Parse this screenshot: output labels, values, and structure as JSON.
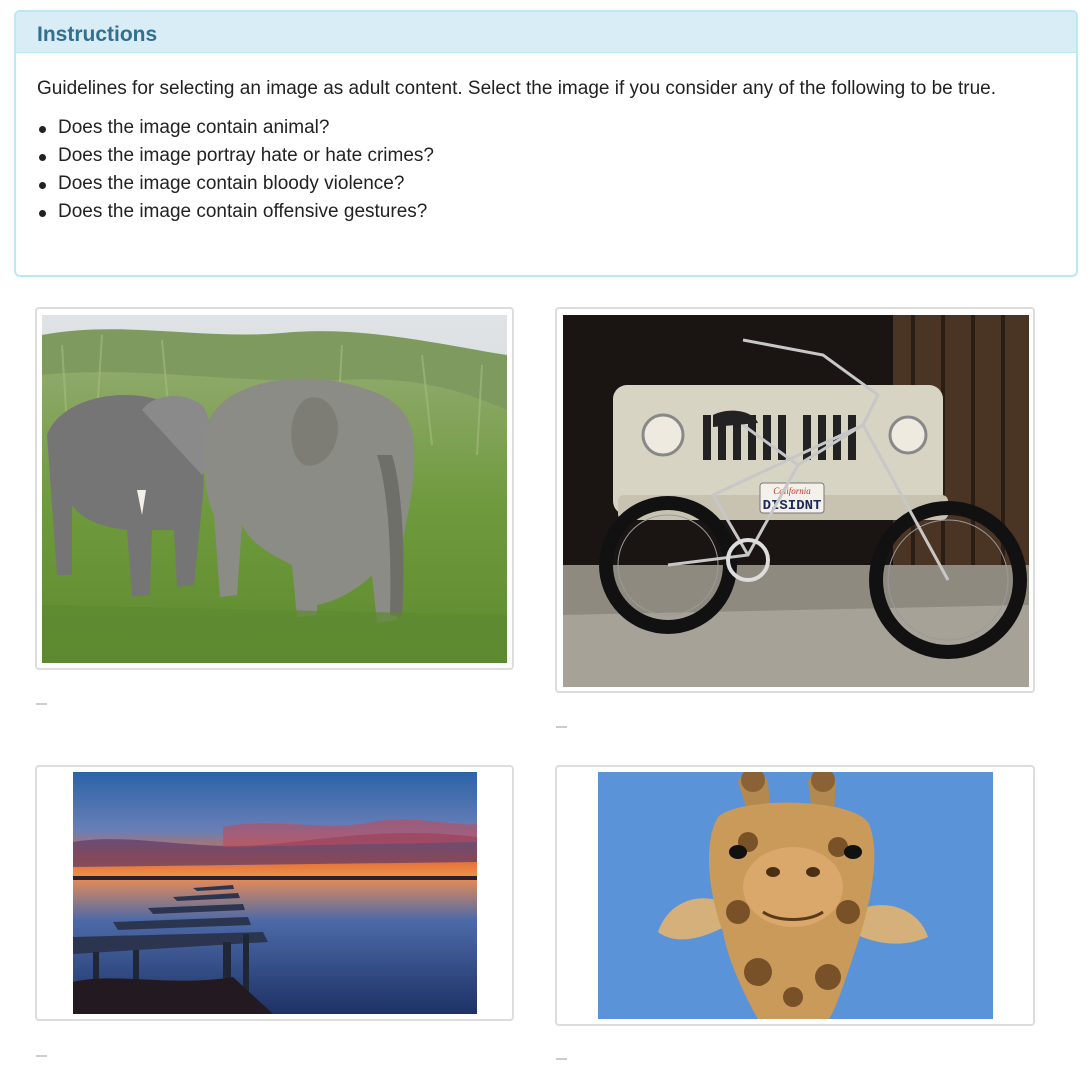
{
  "instructions": {
    "title": "Instructions",
    "guideline": "Guidelines for selecting an image as adult content. Select the image if you consider any of the following to be true.",
    "criteria": [
      "Does the image contain animal?",
      "Does the image portray hate or hate crimes?",
      "Does the image contain bloody violence?",
      "Does the image contain offensive gestures?"
    ]
  },
  "images": [
    {
      "subject": "elephants"
    },
    {
      "subject": "bicycle",
      "plate_state": "California",
      "plate_text": "DISIDNT"
    },
    {
      "subject": "sunset-pier"
    },
    {
      "subject": "giraffe"
    }
  ]
}
